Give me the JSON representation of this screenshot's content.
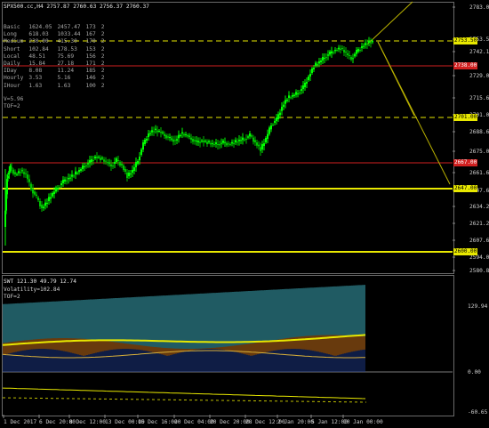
{
  "chart_window": {
    "symbol_header": "SPX500.cc,H4  2757.87 2760.63 2756.37 2760.37",
    "stats_rows": [
      {
        "name": "Basic",
        "v1": "1624.05",
        "v2": "2457.47",
        "v3": "173",
        "v4": "2"
      },
      {
        "name": "Long",
        "v1": "618.03",
        "v2": "1033.44",
        "v3": "167",
        "v4": "2"
      },
      {
        "name": "Medium",
        "v1": "230.00",
        "v2": "415.30",
        "v3": "170",
        "v4": "2"
      },
      {
        "name": "Short",
        "v1": "102.84",
        "v2": "178.53",
        "v3": "153",
        "v4": "2"
      },
      {
        "name": "Local",
        "v1": "48.51",
        "v2": "75.69",
        "v3": "156",
        "v4": "2"
      },
      {
        "name": "Daily",
        "v1": "15.84",
        "v2": "27.18",
        "v3": "171",
        "v4": "2"
      },
      {
        "name": "IDay",
        "v1": "8.08",
        "v2": "11.24",
        "v3": "185",
        "v4": "2"
      },
      {
        "name": "Hourly",
        "v1": "3.53",
        "v2": "5.16",
        "v3": "146",
        "v4": "2"
      },
      {
        "name": "IHour",
        "v1": "1.63",
        "v2": "1.63",
        "v3": "100",
        "v4": "2"
      }
    ],
    "stats_footer": [
      "V=5.96",
      "TOF=2"
    ],
    "price_ticks": [
      "2783.00",
      "2753.50",
      "2742.15",
      "2729.05",
      "2715.60",
      "2701.00",
      "2688.60",
      "2675.00",
      "2661.60",
      "2647.60",
      "2634.25",
      "2621.20",
      "2607.60",
      "2594.00",
      "2580.80"
    ],
    "level_labels": [
      {
        "text": "2753.50",
        "kind": "yellow-dashed"
      },
      {
        "text": "2738.00",
        "kind": "red"
      },
      {
        "text": "2701.00",
        "kind": "yellow-dashed"
      },
      {
        "text": "2667.00",
        "kind": "red"
      },
      {
        "text": "2647.00",
        "kind": "yellow"
      },
      {
        "text": "2600.00",
        "kind": "yellow"
      }
    ],
    "indicator_header": "SWT 121.30 49.79 12.74",
    "indicator_lines": [
      "Volatility=102.84",
      "TOF=2"
    ],
    "indicator_ticks": [
      "129.94",
      "0.00",
      "-60.65"
    ],
    "time_labels": [
      "1 Dec 2017",
      "6 Dec 20:00",
      "8 Dec 12:00",
      "13 Dec 00:00",
      "15 Dec 16:00",
      "20 Dec 04:00",
      "20 Dec 20:00",
      "28 Dec 12:00",
      "2 Jan 20:00",
      "5 Jan 12:00",
      "10 Jan 00:00"
    ],
    "colors": {
      "background": "#000000",
      "bull_candle": "#00ff00",
      "bear_candle": "#00c000",
      "level_yellow": "#e8e800",
      "level_red": "#d02020",
      "trend_line": "#b8b000",
      "hist_cyan": "#3fb6c6",
      "hist_orange": "#d0751a",
      "hist_navy": "#1e3a8a"
    }
  }
}
